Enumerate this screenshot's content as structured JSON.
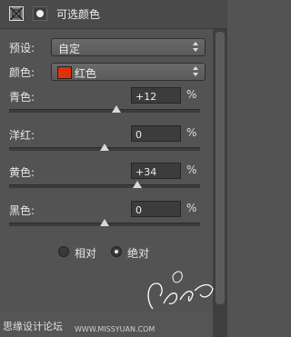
{
  "panel": {
    "title": "可选颜色",
    "preset_label": "预设:",
    "preset_value": "自定",
    "colors_label": "颜色:",
    "colors_value": "红色",
    "swatch_color": "#e0300c"
  },
  "sliders": [
    {
      "label": "青色:",
      "value": "+12",
      "unit": "%",
      "level": 12
    },
    {
      "label": "洋红:",
      "value": "0",
      "unit": "%",
      "level": 0
    },
    {
      "label": "黄色:",
      "value": "+34",
      "unit": "%",
      "level": 34
    },
    {
      "label": "黑色:",
      "value": "0",
      "unit": "%",
      "level": 0
    }
  ],
  "method": {
    "relative_label": "相对",
    "absolute_label": "绝对",
    "selected": "absolute"
  },
  "watermarks": {
    "left_text": "思缘设计论坛",
    "site_text": "WWW.MISSYUAN.COM",
    "logo_text": "教程"
  }
}
